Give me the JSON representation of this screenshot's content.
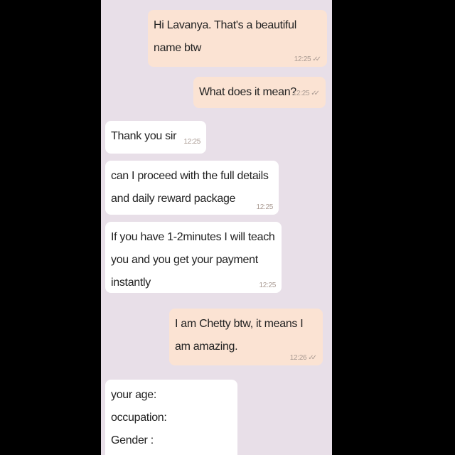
{
  "messages": [
    {
      "direction": "outgoing",
      "text": "Hi Lavanya. That's a beautiful name btw",
      "time": "12:25"
    },
    {
      "direction": "outgoing",
      "text": "What does it mean?",
      "time": "12:25"
    },
    {
      "direction": "incoming",
      "text": "Thank you sir",
      "time": "12:25"
    },
    {
      "direction": "incoming",
      "text": "can I proceed with the full details and daily reward package",
      "time": "12:25"
    },
    {
      "direction": "incoming",
      "text": "If you have 1-2minutes I will teach you and you get your payment instantly",
      "time": "12:25"
    },
    {
      "direction": "outgoing",
      "text": "I am Chetty btw, it means I am amazing.",
      "time": "12:26"
    },
    {
      "direction": "incoming",
      "text": "your age:\noccupation:\nGender :",
      "time": ""
    }
  ],
  "colors": {
    "outgoing": "#fbe3d3",
    "incoming": "#ffffff",
    "background": "#e8dfe8"
  },
  "icons": {
    "read_receipt": "double-check-icon"
  }
}
